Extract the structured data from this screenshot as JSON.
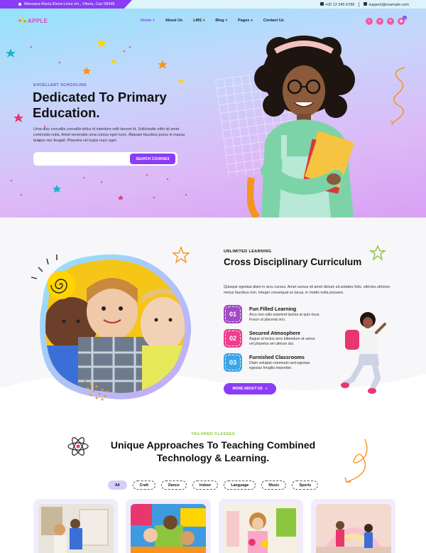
{
  "topbar": {
    "address": "Manzana María Elena Leiva s/n., Vitoria, Can 58948",
    "phone": "+00 12 345 6789",
    "email": "support@example.com"
  },
  "brand": {
    "name": "APPLE"
  },
  "nav": {
    "items": [
      {
        "label": "Home",
        "active": true,
        "dropdown": true
      },
      {
        "label": "About Us",
        "active": false,
        "dropdown": false
      },
      {
        "label": "LMS",
        "active": false,
        "dropdown": true
      },
      {
        "label": "Blog",
        "active": false,
        "dropdown": true
      },
      {
        "label": "Pages",
        "active": false,
        "dropdown": true
      },
      {
        "label": "Contact Us",
        "active": false,
        "dropdown": false
      }
    ],
    "cart_count": "0"
  },
  "hero": {
    "eyebrow": "EXCELLENT SCHOOLING",
    "title": "Dedicated To Primary Education.",
    "description": "Urna duis convallis convallis tellus id interdum velit laoreet id. Sollicitudin nibh sit amet commodo nulla. Amet venenatis urna cursus eget nunc. Aliquam faucibus purus in massa tempor nec feugiat. Pharetra vel turpis nunc eget.",
    "search_placeholder": "",
    "search_button": "SEARCH COURSES"
  },
  "curriculum": {
    "eyebrow": "UNLIMITED LEARNING",
    "title": "Cross Disciplinary Curriculum",
    "description": "Quisque egestas diam in arcu cursus. Amet cursus sit amet dictum sit.sodales felis, ultricies ultricies metus faucibus non. Integer consequat ex lacus, in mattis nulla posuere.",
    "features": [
      {
        "num": "01",
        "title": "Fun Filled Learning",
        "text": "Arcu non odio euismod lacinia at quis risus. Fusce ut placerat orci.",
        "color": "#a24bc4"
      },
      {
        "num": "02",
        "title": "Secured Atmosphere",
        "text": "Augue ut lectus arcu bibendum at varius vel pharetra vel ultrices dui.",
        "color": "#ee3d8c"
      },
      {
        "num": "03",
        "title": "Furnished Classrooms",
        "text": "Diam volutpat commodo sed egestas egestas fringilla imperdiet.",
        "color": "#3aa6e8"
      }
    ],
    "button": "MORE ABOUT US"
  },
  "classes": {
    "eyebrow": "TAILORED CLASSES",
    "title": "Unique Approaches To Teaching Combined Technology & Learning.",
    "filters": [
      "All",
      "Craft",
      "Dance",
      "Indoor",
      "Language",
      "Music",
      "Sports"
    ]
  },
  "colors": {
    "accent": "#8b3cf6",
    "pink": "#f35aa6",
    "green": "#8cc63f"
  }
}
